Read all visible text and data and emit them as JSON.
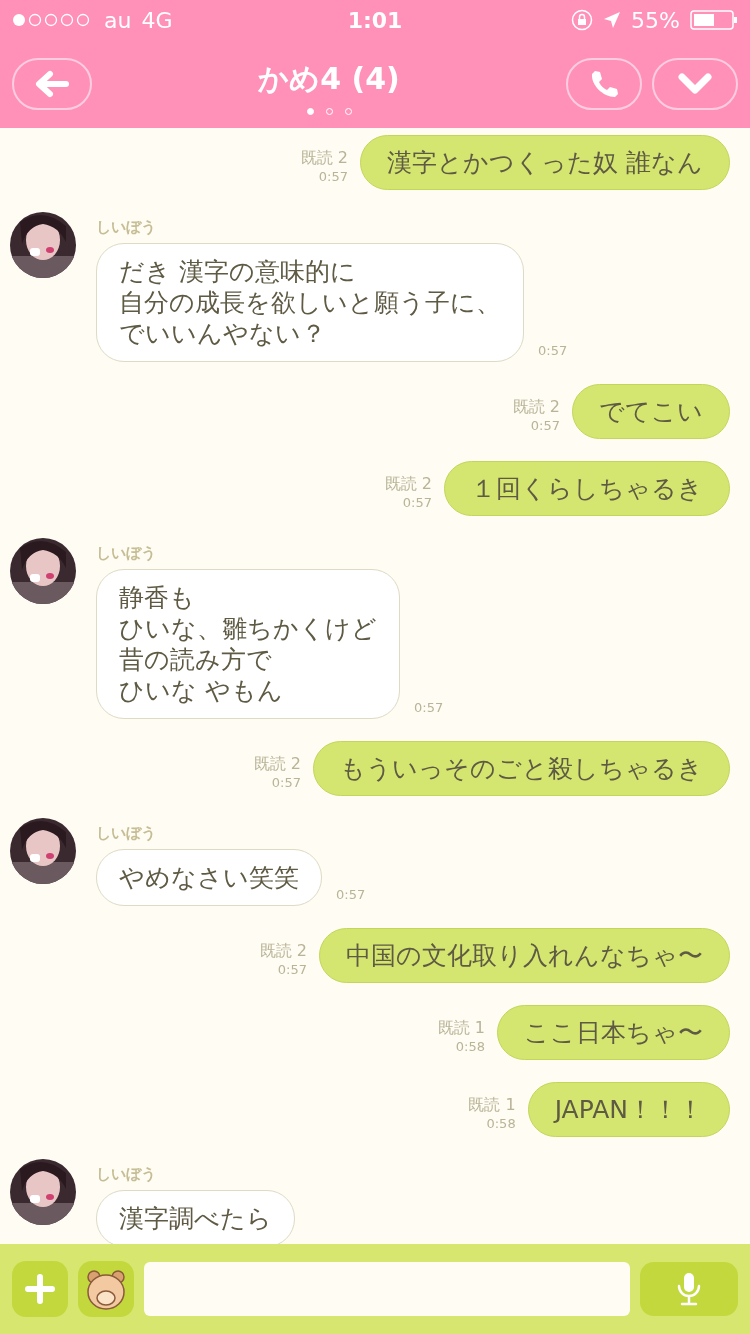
{
  "status_bar": {
    "carrier": "au",
    "network": "4G",
    "time": "1:01",
    "battery": "55%"
  },
  "header": {
    "title": "かめ4 (4)",
    "pages": [
      {
        "selected": true
      },
      {
        "selected": false
      },
      {
        "selected": false
      }
    ]
  },
  "messages": [
    {
      "kind": "sent",
      "read": "既読 2",
      "time": "0:57",
      "text": "漢字とかつくった奴 誰なん"
    },
    {
      "kind": "received",
      "sender": "しいぼう",
      "lines": [
        "だき 漢字の意味的に",
        "自分の成長を欲しいと願う子に、",
        "でいいんやない？"
      ],
      "time": "0:57"
    },
    {
      "kind": "sent",
      "read": "既読 2",
      "time": "0:57",
      "text": "でてこい"
    },
    {
      "kind": "sent",
      "read": "既読 2",
      "time": "0:57",
      "text": "１回くらしちゃるき"
    },
    {
      "kind": "received",
      "sender": "しいぼう",
      "lines": [
        "静香も",
        "ひいな、雛ちかくけど",
        "昔の読み方で",
        "ひいな やもん"
      ],
      "time": "0:57"
    },
    {
      "kind": "sent",
      "read": "既読 2",
      "time": "0:57",
      "text": "もういっそのごと殺しちゃるき"
    },
    {
      "kind": "received",
      "sender": "しいぼう",
      "lines": [
        "やめなさい笑笑"
      ],
      "time": "0:57"
    },
    {
      "kind": "sent",
      "read": "既読 2",
      "time": "0:57",
      "text": "中国の文化取り入れんなちゃ〜"
    },
    {
      "kind": "sent",
      "read": "既読 1",
      "time": "0:58",
      "text": "ここ日本ちゃ〜"
    },
    {
      "kind": "sent",
      "read": "既読 1",
      "time": "0:58",
      "text": "JAPAN！！！"
    },
    {
      "kind": "received",
      "sender": "しいぼう",
      "lines": [
        "漢字調べたら"
      ]
    }
  ]
}
